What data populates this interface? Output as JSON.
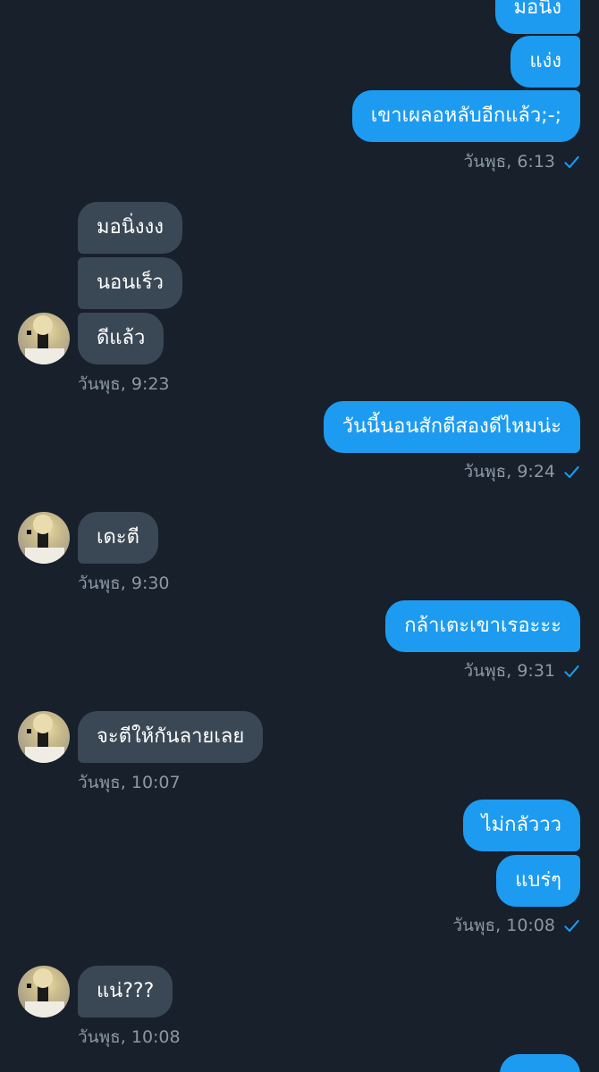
{
  "theme": {
    "background": "#17202b",
    "sent_bubble": "#1d9bf0",
    "received_bubble": "#3a4856",
    "timestamp_text": "#8b98a5",
    "read_check": "#1d9bf0"
  },
  "messages": {
    "m1": "มอนิ่ง",
    "m2": "แง่ง",
    "m3": "เขาเผลอหลับอีกแล้ว;-;",
    "t1": "วันพุธ, 6:13",
    "m4": "มอนิ่งงง",
    "m5": "นอนเร็ว",
    "m6": "ดีแล้ว",
    "t2": "วันพุธ, 9:23",
    "m7": "วันนี้นอนสักตีสองดีไหมน่ะ",
    "t3": "วันพุธ, 9:24",
    "m8": "เดะตี",
    "t4": "วันพุธ, 9:30",
    "m9": "กล้าเตะเขาเรอะะะ",
    "t5": "วันพุธ, 9:31",
    "m10": "จะตีให้กันลายเลย",
    "t6": "วันพุธ, 10:07",
    "m11": "ไม่กลัววว",
    "m12": "แบร่ๆ",
    "t7": "วันพุธ, 10:08",
    "m13": "แน่???",
    "t8": "วันพุธ, 10:08"
  },
  "icons": {
    "read_receipt": "check-icon",
    "contact_avatar": "avatar"
  }
}
